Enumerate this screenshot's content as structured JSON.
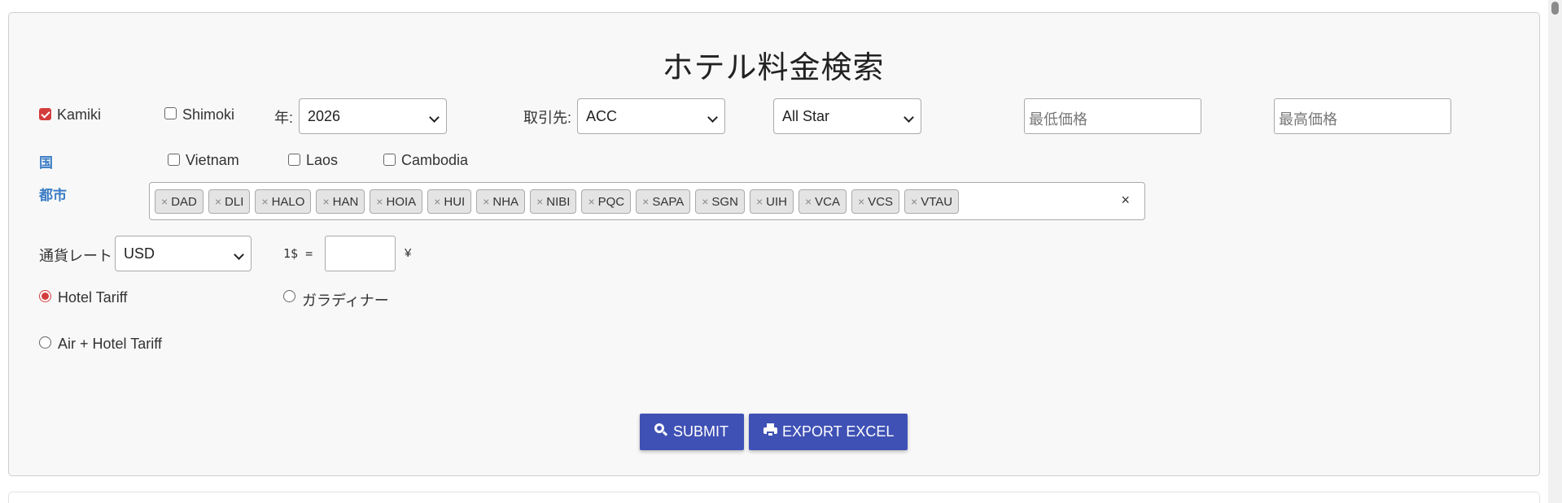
{
  "page": {
    "title": "ホテル料金検索"
  },
  "companies": [
    {
      "label": "Kamiki",
      "checked": true
    },
    {
      "label": "Shimoki",
      "checked": false
    }
  ],
  "year": {
    "label": "年:",
    "value": "2026"
  },
  "partner": {
    "label": "取引先:",
    "value": "ACC"
  },
  "star": {
    "value": "All Star"
  },
  "price": {
    "min_placeholder": "最低価格",
    "max_placeholder": "最高価格"
  },
  "country": {
    "label": "国",
    "options": [
      {
        "label": "Vietnam",
        "checked": false
      },
      {
        "label": "Laos",
        "checked": false
      },
      {
        "label": "Cambodia",
        "checked": false
      }
    ]
  },
  "city": {
    "label": "都市",
    "remove_glyph": "×",
    "clear_glyph": "×",
    "tags": [
      "DAD",
      "DLI",
      "HALO",
      "HAN",
      "HOIA",
      "HUI",
      "NHA",
      "NIBI",
      "PQC",
      "SAPA",
      "SGN",
      "UIH",
      "VCA",
      "VCS",
      "VTAU"
    ]
  },
  "currency": {
    "label": "通貨レート",
    "value": "USD",
    "rate_prefix": "1$ =",
    "rate_value": "",
    "yen_symbol": "¥"
  },
  "tariff": {
    "selected": "Hotel Tariff",
    "options": [
      "Hotel Tariff",
      "ガラディナー",
      "Air + Hotel Tariff"
    ]
  },
  "actions": {
    "submit_label": "SUBMIT",
    "export_label": "EXPORT EXCEL",
    "submit_icon": "search-icon",
    "export_icon": "printer-icon",
    "button_color": "#3f51b5"
  },
  "colors": {
    "accent": "#d43c3c",
    "label_blue": "#3a7cc5"
  }
}
